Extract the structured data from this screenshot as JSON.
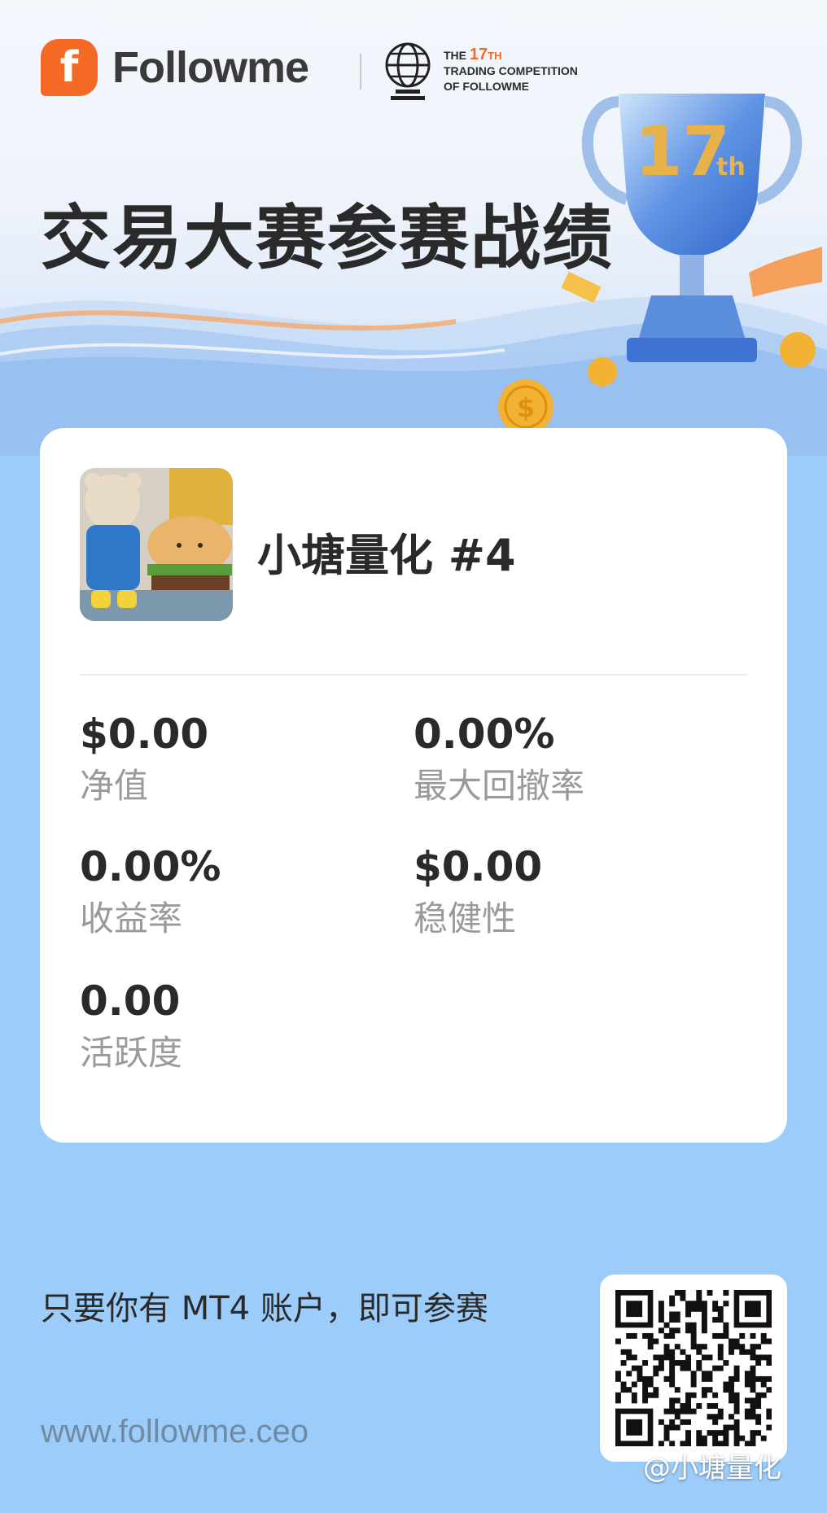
{
  "brand": {
    "logo_letter": "f",
    "name": "Followme",
    "competition": {
      "the": "THE",
      "number": "17",
      "suffix": "TH",
      "line2": "TRADING COMPETITION",
      "line3": "OF FOLLOWME"
    }
  },
  "hero": {
    "title": "交易大赛参赛战绩",
    "trophy": {
      "number": "17",
      "suffix": "th",
      "icon": "trophy-icon"
    }
  },
  "card": {
    "trader_name": "小塘量化 #4",
    "stats": [
      {
        "value": "$0.00",
        "label": "净值"
      },
      {
        "value": "0.00%",
        "label": "最大回撤率"
      },
      {
        "value": "0.00%",
        "label": "收益率"
      },
      {
        "value": "$0.00",
        "label": "稳健性"
      },
      {
        "value": "0.00",
        "label": "活跃度"
      }
    ]
  },
  "footer": {
    "promo": "只要你有 MT4 账户，即可参赛",
    "url": "www.followme.ceo",
    "qr_icon": "qr-code",
    "watermark": "@小塘量化"
  },
  "colors": {
    "accent": "#f46a25",
    "background": "#9ccdfa",
    "card": "#ffffff",
    "text": "#2a2a2a",
    "muted": "#9a9a9a"
  }
}
